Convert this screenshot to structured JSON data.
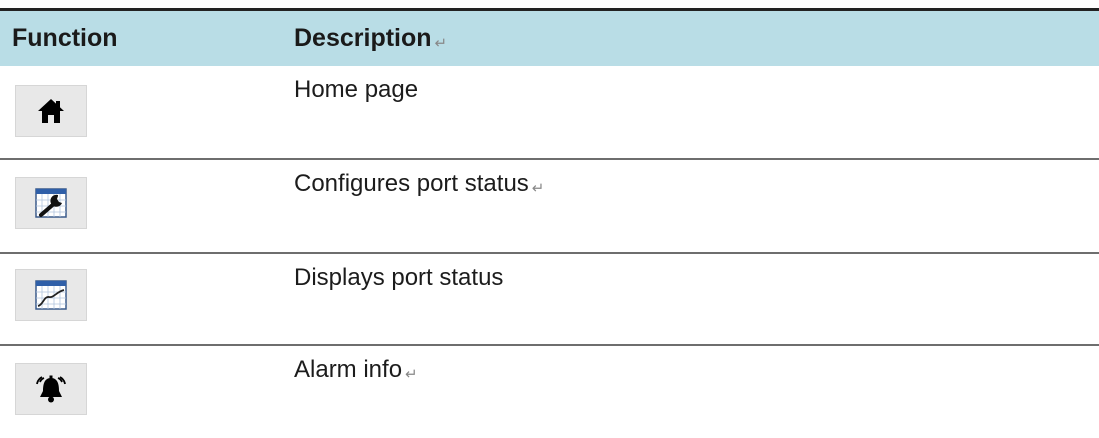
{
  "header": {
    "function_label": "Function",
    "description_label": "Description",
    "description_mark": "↵"
  },
  "rows": [
    {
      "icon": "home-icon",
      "description": "Home page",
      "mark": ""
    },
    {
      "icon": "configure-wrench-icon",
      "description": "Configures port status",
      "mark": "↵"
    },
    {
      "icon": "port-status-chart-icon",
      "description": "Displays port status",
      "mark": ""
    },
    {
      "icon": "alarm-bell-icon",
      "description": "Alarm info",
      "mark": "↵"
    }
  ]
}
